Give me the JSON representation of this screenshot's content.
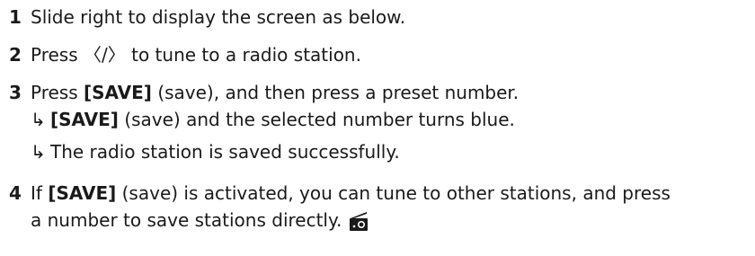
{
  "steps": [
    {
      "number": "1",
      "text": "Slide right to display the screen as below."
    },
    {
      "number": "2",
      "text_pre": "Press",
      "left_glyph": "〈",
      "separator": "/",
      "right_glyph": "〉",
      "text_post": "to tune to a radio station."
    },
    {
      "number": "3",
      "text_pre": "Press",
      "button": "[SAVE]",
      "text_post": "(save), and then press a preset number.",
      "results": [
        {
          "arrow": "↳",
          "button": "[SAVE]",
          "text": "(save) and the selected number turns blue."
        },
        {
          "arrow": "↳",
          "text": "The radio station is saved successfully."
        }
      ]
    },
    {
      "number": "4",
      "text_pre": "If",
      "button": "[SAVE]",
      "text_post": "(save) is activated, you can tune to other stations, and press",
      "text_line2": "a number to save stations directly.",
      "icon": "radio-icon"
    }
  ]
}
